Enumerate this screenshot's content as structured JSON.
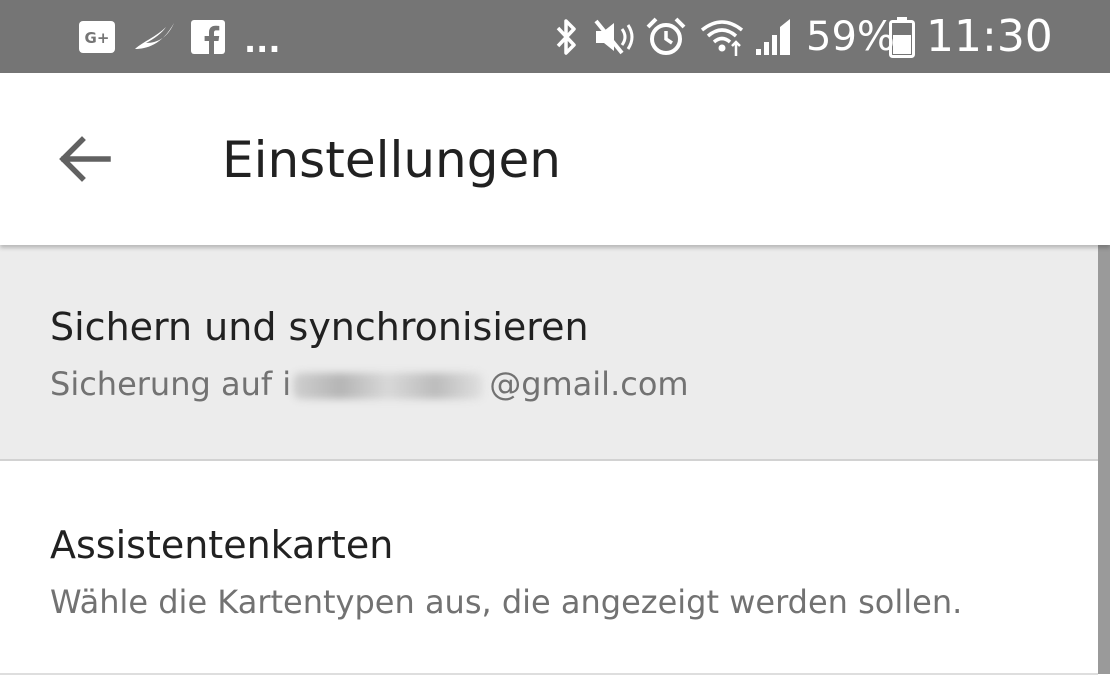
{
  "status_bar": {
    "notification_icons": [
      "google-plus-icon",
      "feather-icon",
      "facebook-icon"
    ],
    "more_indicator": "...",
    "system_icons": [
      "bluetooth-icon",
      "mute-icon",
      "alarm-icon",
      "wifi-icon",
      "signal-icon"
    ],
    "battery_percent": "59%",
    "time": "11:30",
    "background_color": "#757575"
  },
  "app_bar": {
    "back_icon": "arrow-back-icon",
    "title": "Einstellungen"
  },
  "settings": [
    {
      "title": "Sichern und synchronisieren",
      "subtitle_prefix": "Sicherung auf i",
      "subtitle_suffix": "@gmail.com",
      "highlighted": true
    },
    {
      "title": "Assistentenkarten",
      "subtitle": "Wähle die Kartentypen aus, die angezeigt werden sollen.",
      "highlighted": false
    }
  ]
}
